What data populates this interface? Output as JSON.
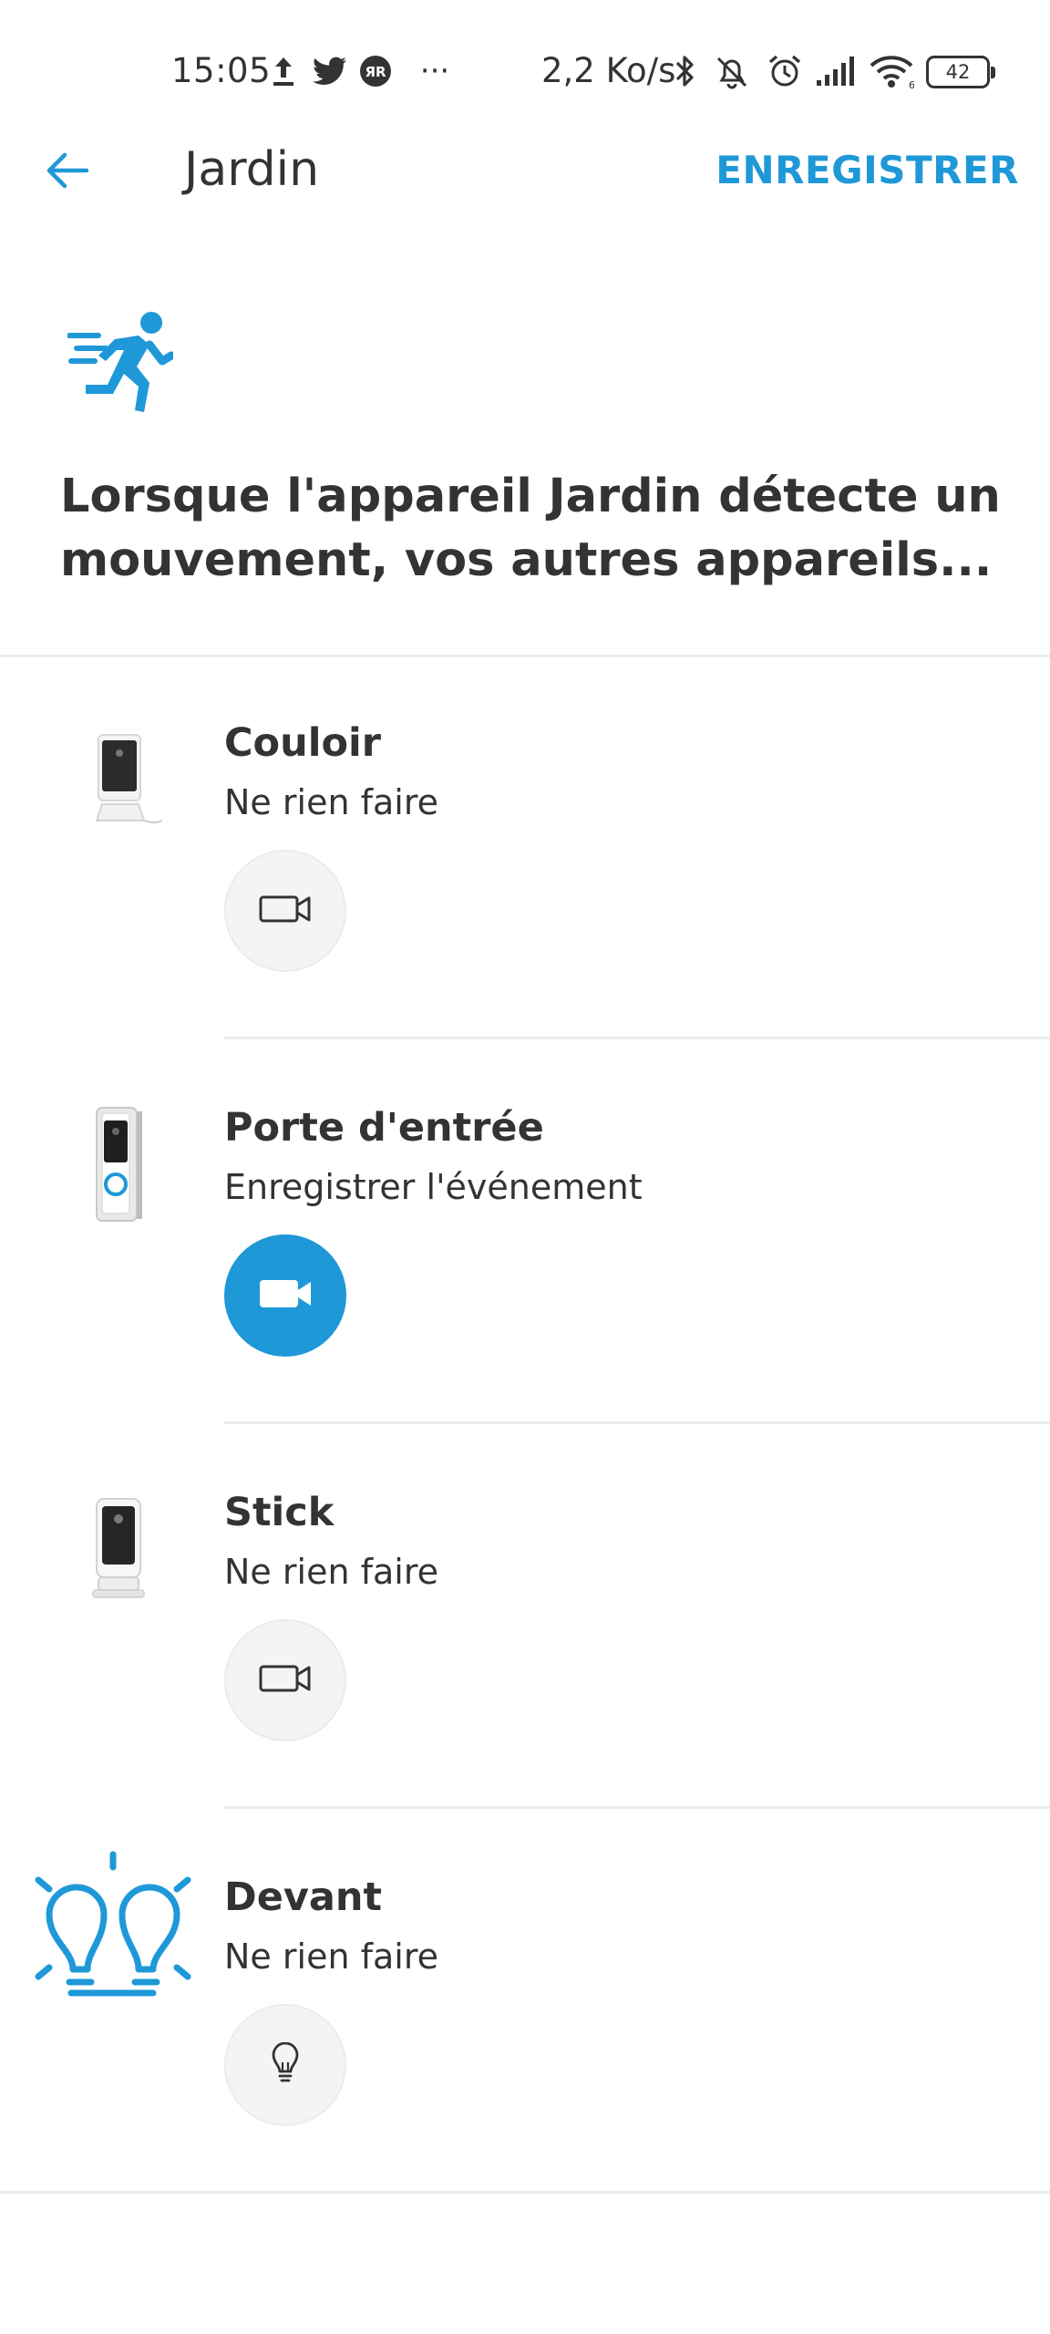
{
  "status_bar": {
    "time": "15:05",
    "speed": "2,2 Ko/s",
    "battery": "42",
    "more": "···"
  },
  "app_bar": {
    "title": "Jardin",
    "save_label": "ENREGISTRER"
  },
  "header": {
    "text": "Lorsque l'appareil Jardin détecte un mouvement, vos autres appareils..."
  },
  "devices": [
    {
      "name": "Couloir",
      "action": "Ne rien faire",
      "type": "indoor-camera",
      "active": false,
      "button_icon": "video-camera-outline-icon"
    },
    {
      "name": "Porte d'entrée",
      "action": "Enregistrer l'événement",
      "type": "doorbell",
      "active": true,
      "button_icon": "video-camera-filled-icon"
    },
    {
      "name": "Stick",
      "action": "Ne rien faire",
      "type": "stick-camera",
      "active": false,
      "button_icon": "video-camera-outline-icon"
    },
    {
      "name": "Devant",
      "action": "Ne rien faire",
      "type": "smart-lights",
      "active": false,
      "button_icon": "lightbulb-icon"
    }
  ],
  "colors": {
    "accent": "#1f98d8",
    "text": "#333333",
    "divider": "#ececec",
    "button_bg": "#f3f4f6"
  }
}
